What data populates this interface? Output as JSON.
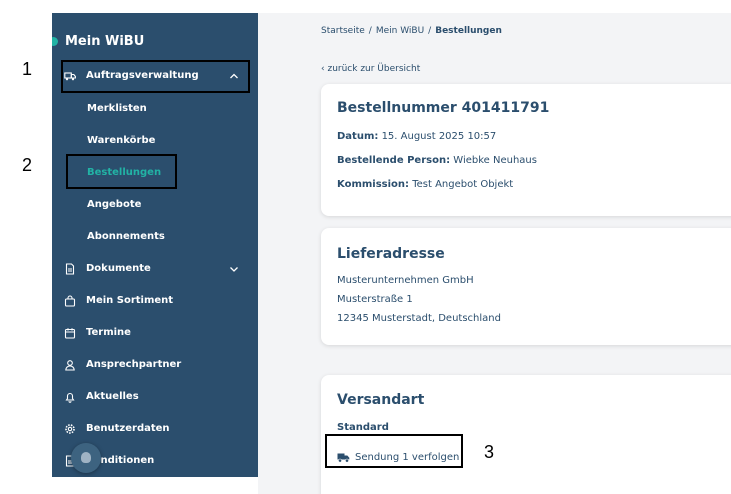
{
  "sidebar": {
    "title": "Mein WiBU",
    "nav": [
      {
        "label": "Auftragsverwaltung",
        "icon": "truck-icon",
        "chevron": "chevron-up-icon"
      },
      {
        "label": "Dokumente",
        "icon": "document-icon",
        "chevron": "chevron-down-icon"
      },
      {
        "label": "Mein Sortiment",
        "icon": "bag-icon"
      },
      {
        "label": "Termine",
        "icon": "calendar-icon"
      },
      {
        "label": "Ansprechpartner",
        "icon": "person-icon"
      },
      {
        "label": "Aktuelles",
        "icon": "bell-icon"
      },
      {
        "label": "Benutzerdaten",
        "icon": "gear-icon"
      },
      {
        "label": "Konditionen",
        "icon": "document-icon"
      }
    ],
    "subitems": [
      "Merklisten",
      "Warenkörbe",
      "Bestellungen",
      "Angebote",
      "Abonnements"
    ],
    "active_subitem": "Bestellungen"
  },
  "breadcrumb": [
    "Startseite",
    "Mein WiBU",
    "Bestellungen"
  ],
  "back_link": "zurück zur Übersicht",
  "order": {
    "title": "Bestellnummer 401411791",
    "date_label": "Datum:",
    "date_value": "15. August 2025 10:57",
    "person_label": "Bestellende Person:",
    "person_value": "Wiebke Neuhaus",
    "commission_label": "Kommission:",
    "commission_value": "Test Angebot Objekt"
  },
  "delivery": {
    "title": "Lieferadresse",
    "lines": [
      "Musterunternehmen GmbH",
      "Musterstraße 1",
      "12345 Musterstadt, Deutschland"
    ]
  },
  "shipping": {
    "title": "Versandart",
    "method": "Standard",
    "track_label": "Sendung 1 verfolgen"
  },
  "annotations": [
    "1",
    "2",
    "3"
  ],
  "colors": {
    "sidebar": "#2b4e6d",
    "accent": "#22b3a5",
    "text": "#2b4e6d"
  }
}
